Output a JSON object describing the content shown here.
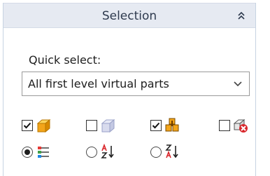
{
  "panel": {
    "title": "Selection",
    "collapse_icon": "double-chevron-up-icon"
  },
  "quick_select": {
    "label": "Quick select:",
    "value": "All first level virtual parts",
    "arrow_icon": "chevron-down-icon"
  },
  "filters": [
    {
      "icon": "solid-part-icon",
      "checked": true
    },
    {
      "icon": "surface-part-icon",
      "checked": false
    },
    {
      "icon": "assembly-icon",
      "checked": true
    },
    {
      "icon": "hidden-part-icon",
      "checked": false
    }
  ],
  "sort_options": [
    {
      "icon": "tree-order-icon",
      "selected": true
    },
    {
      "icon": "sort-ascending-icon",
      "selected": false
    },
    {
      "icon": "sort-descending-icon",
      "selected": false
    }
  ],
  "colors": {
    "header_bg": "#e6eaf2",
    "border": "#c7d3e2",
    "accent_orange": "#f3a51a",
    "accent_red": "#d9262b"
  }
}
